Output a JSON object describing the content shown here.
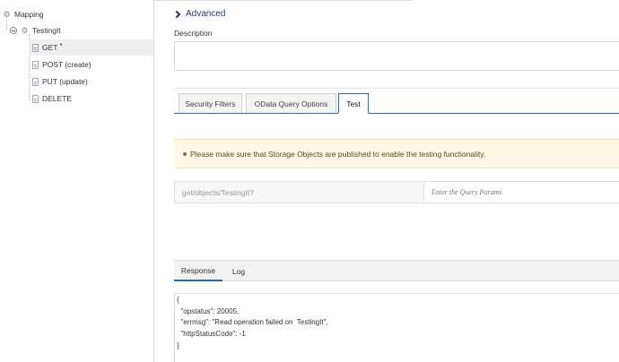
{
  "sidebar": {
    "root_label": "Mapping",
    "object_label": "TestingIt",
    "items": [
      {
        "label": "GET",
        "modified_marker": "*"
      },
      {
        "label": "POST (create)"
      },
      {
        "label": "PUT (update)"
      },
      {
        "label": "DELETE"
      }
    ]
  },
  "main": {
    "section_title": "Advanced",
    "description_label": "Description",
    "description_value": "",
    "tabs": [
      {
        "label": "Security Filters"
      },
      {
        "label": "OData Query Options"
      },
      {
        "label": "Test"
      }
    ],
    "notice": "Please make sure that Storage Objects are published to enable the testing functionality.",
    "endpoint_path": "get/objects/TestingIt?",
    "query_params_placeholder": "Enter the Query Params",
    "response_tabs": [
      {
        "label": "Response"
      },
      {
        "label": "Log"
      }
    ],
    "response_lines": [
      "{",
      "  \"opstatus\": 20005,",
      "  \"errmsg\": \"Read operation failed on  TestingIt\",",
      "  \"httpStatusCode\": -1",
      "}"
    ]
  },
  "colors": {
    "accent": "#2b6aa3",
    "notice_bg": "#fcf8e3",
    "title": "#1f3a5f"
  },
  "icons": [
    "collapse-icon",
    "gear-icon",
    "document-icon",
    "chevron-right-icon",
    "bullet-icon"
  ]
}
